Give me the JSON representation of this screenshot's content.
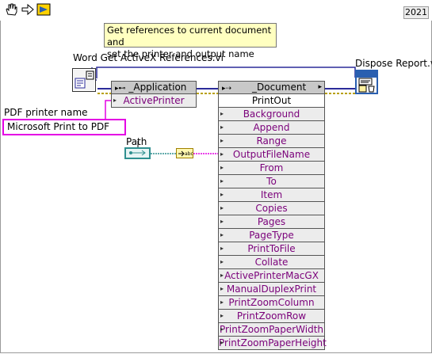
{
  "toolbar": {
    "tools": [
      "hand-icon",
      "step-icon",
      "lightbulb-icon"
    ],
    "year": "2021"
  },
  "comment": {
    "line1": "Get references to current document and",
    "line2": "set the printer and output name"
  },
  "subvis": {
    "get_refs_label": "Word Get ActiveX References.vi",
    "dispose_label": "Dispose Report.vi"
  },
  "pdf_control": {
    "label": "PDF printer name",
    "value": "Microsoft Print to PDF"
  },
  "path_control": {
    "label": "Path"
  },
  "application_node": {
    "title": "_Application",
    "property": "ActivePrinter"
  },
  "document_node": {
    "title": "_Document",
    "method": "PrintOut",
    "params": [
      "Background",
      "Append",
      "Range",
      "OutputFileName",
      "From",
      "To",
      "Item",
      "Copies",
      "Pages",
      "PageType",
      "PrintToFile",
      "Collate",
      "ActivePrinterMacGX",
      "ManualDuplexPrint",
      "PrintZoomColumn",
      "PrintZoomRow",
      "PrintZoomPaperWidth",
      "PrintZoomPaperHeight"
    ]
  },
  "colors": {
    "refnum_wire": "#2b2b9a",
    "error_wire": "#b8a000",
    "string_wire": "#e400e4",
    "path_wire": "#2f8f8f",
    "property_text": "#7a007a"
  }
}
